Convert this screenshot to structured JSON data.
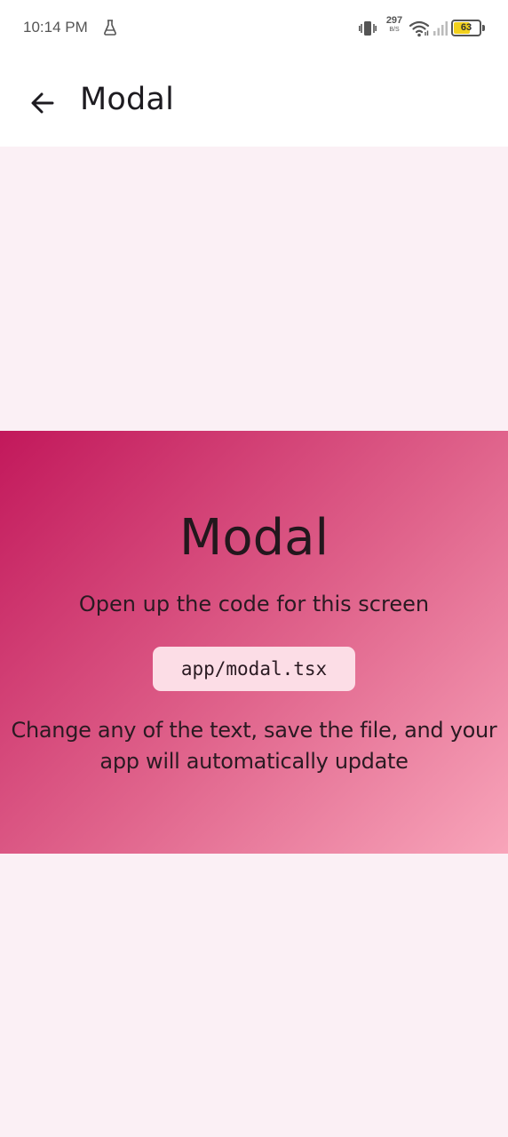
{
  "status_bar": {
    "time": "10:14 PM",
    "net_speed_value": "297",
    "net_speed_unit": "B/S",
    "battery_level": "63",
    "battery_fraction": 0.63,
    "icons": [
      "flask-icon",
      "vibrate-icon",
      "wifi-icon",
      "signal-icon",
      "battery-icon"
    ]
  },
  "app_bar": {
    "back_icon": "arrow-left-icon",
    "title": "Modal"
  },
  "modal": {
    "title": "Modal",
    "subtitle": "Open up the code for this screen",
    "code_path": "app/modal.tsx",
    "body_line_1": "Change any of the text, save the file, and your",
    "body_line_2": "app will automatically update"
  },
  "colors": {
    "background": "#fbf0f5",
    "gradient_start": "#c2185b",
    "gradient_end": "#f8a5ba",
    "code_chip_bg": "#fcdde6",
    "battery_fill": "#f2d11d"
  }
}
